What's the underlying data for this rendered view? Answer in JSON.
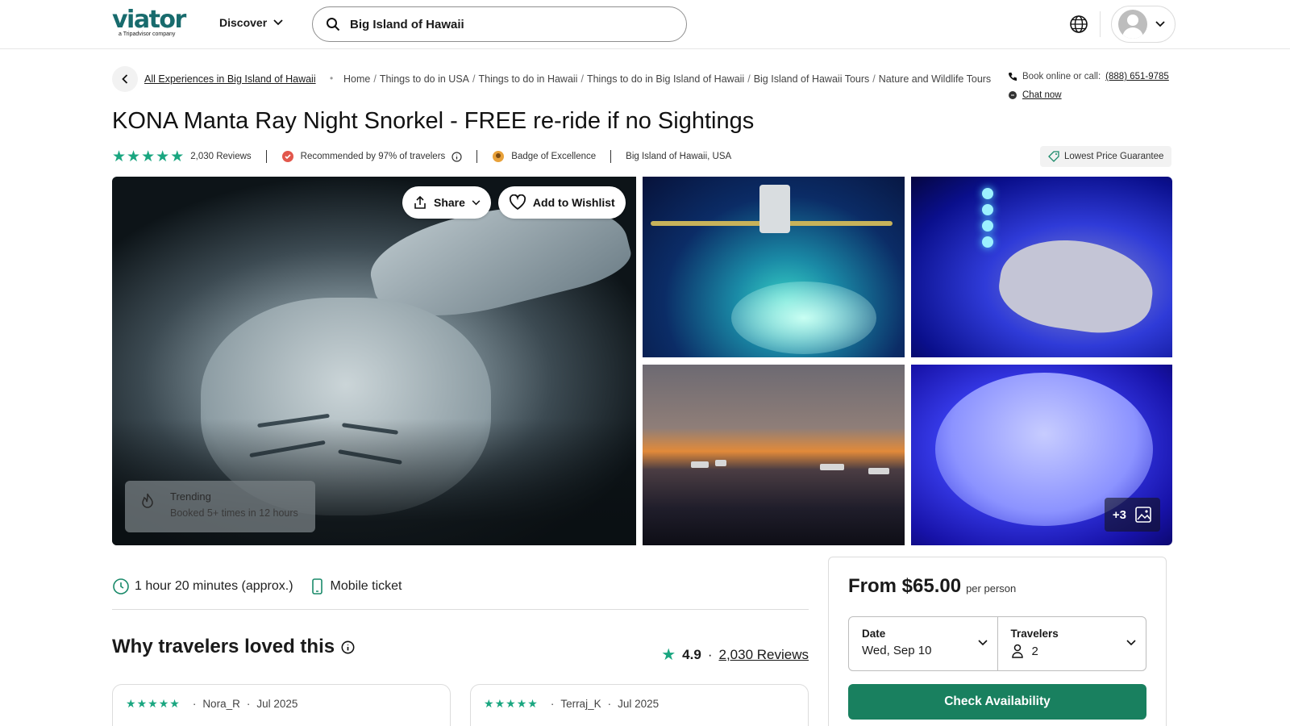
{
  "header": {
    "logo": "viator",
    "logo_sub": "a Tripadvisor company",
    "discover_label": "Discover",
    "search_value": "Big Island of Hawaii"
  },
  "breadcrumb": {
    "back_link": "All Experiences in Big Island of Hawaii",
    "items": [
      "Home",
      "Things to do in USA",
      "Things to do in Hawaii",
      "Things to do in Big Island of Hawaii",
      "Big Island of Hawaii Tours",
      "Nature and Wildlife Tours"
    ]
  },
  "contact": {
    "book_text": "Book online or call:",
    "phone": "(888) 651-9785",
    "chat": "Chat now"
  },
  "product": {
    "title": "KONA Manta Ray Night Snorkel - FREE re-ride if no Sightings",
    "rating_stars": 5,
    "reviews_count": "2,030 Reviews",
    "recommended": "Recommended by 97% of travelers",
    "badge": "Badge of Excellence",
    "location": "Big Island of Hawaii, USA",
    "lowest_price": "Lowest Price Guarantee"
  },
  "gallery": {
    "share_label": "Share",
    "wishlist_label": "Add to Wishlist",
    "trending_title": "Trending",
    "trending_sub": "Booked 5+ times in 12 hours",
    "more_photos": "+3"
  },
  "features": {
    "duration": "1 hour 20 minutes (approx.)",
    "ticket": "Mobile ticket"
  },
  "reviews_section": {
    "heading": "Why travelers loved this",
    "score": "4.9",
    "count_link": "2,030 Reviews",
    "cards": [
      {
        "author": "Nora_R",
        "date": "Jul 2025"
      },
      {
        "author": "Terraj_K",
        "date": "Jul 2025"
      }
    ]
  },
  "booking": {
    "price": "From $65.00",
    "per": "per person",
    "date_label": "Date",
    "date_value": "Wed, Sep 10",
    "travelers_label": "Travelers",
    "travelers_value": "2",
    "cta": "Check Availability"
  },
  "colors": {
    "brand": "#186b6d",
    "star": "#1aa680",
    "cta": "#19805f"
  }
}
